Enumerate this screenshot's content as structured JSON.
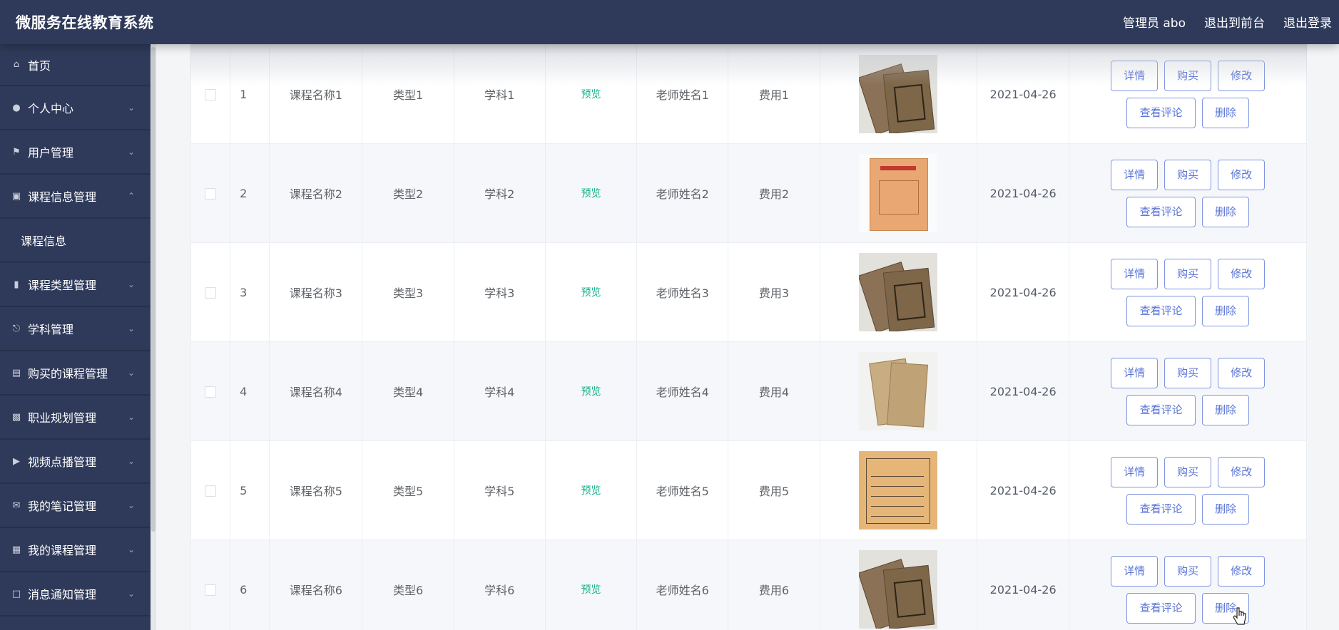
{
  "header": {
    "title": "微服务在线教育系统",
    "user_label": "管理员 abo",
    "goto_front": "退出到前台",
    "logout": "退出登录"
  },
  "sidebar": {
    "items": [
      {
        "label": "首页",
        "icon": "home-icon",
        "expandable": false
      },
      {
        "label": "个人中心",
        "icon": "person-icon",
        "expandable": true
      },
      {
        "label": "用户管理",
        "icon": "flag-icon",
        "expandable": true
      },
      {
        "label": "课程信息管理",
        "icon": "briefcase-icon",
        "expandable": true,
        "expanded": true
      },
      {
        "label": "课程类型管理",
        "icon": "bar-chart-icon",
        "expandable": true
      },
      {
        "label": "学科管理",
        "icon": "microphone-icon",
        "expandable": true
      },
      {
        "label": "购买的课程管理",
        "icon": "clipboard-icon",
        "expandable": true
      },
      {
        "label": "职业规划管理",
        "icon": "monitor-icon",
        "expandable": true
      },
      {
        "label": "视频点播管理",
        "icon": "video-icon",
        "expandable": true
      },
      {
        "label": "我的笔记管理",
        "icon": "mail-icon",
        "expandable": true
      },
      {
        "label": "我的课程管理",
        "icon": "grid-icon",
        "expandable": true
      },
      {
        "label": "消息通知管理",
        "icon": "crop-icon",
        "expandable": true
      }
    ],
    "subitem": "课程信息"
  },
  "table": {
    "actions": {
      "detail": "详情",
      "buy": "购买",
      "edit": "修改",
      "comments": "查看评论",
      "delete": "删除"
    },
    "rows": [
      {
        "index": "1",
        "course_name": "课程名称1",
        "type": "类型1",
        "subject": "学科1",
        "preview": "预览",
        "teacher": "老师姓名1",
        "fee": "费用1",
        "cover": "dark",
        "date": "2021-04-26"
      },
      {
        "index": "2",
        "course_name": "课程名称2",
        "type": "类型2",
        "subject": "学科2",
        "preview": "预览",
        "teacher": "老师姓名2",
        "fee": "费用2",
        "cover": "orange",
        "date": "2021-04-26"
      },
      {
        "index": "3",
        "course_name": "课程名称3",
        "type": "类型3",
        "subject": "学科3",
        "preview": "预览",
        "teacher": "老师姓名3",
        "fee": "费用3",
        "cover": "dark",
        "date": "2021-04-26"
      },
      {
        "index": "4",
        "course_name": "课程名称4",
        "type": "类型4",
        "subject": "学科4",
        "preview": "预览",
        "teacher": "老师姓名4",
        "fee": "费用4",
        "cover": "light",
        "date": "2021-04-26"
      },
      {
        "index": "5",
        "course_name": "课程名称5",
        "type": "类型5",
        "subject": "学科5",
        "preview": "预览",
        "teacher": "老师姓名5",
        "fee": "费用5",
        "cover": "form",
        "date": "2021-04-26"
      },
      {
        "index": "6",
        "course_name": "课程名称6",
        "type": "类型6",
        "subject": "学科6",
        "preview": "预览",
        "teacher": "老师姓名6",
        "fee": "费用6",
        "cover": "dark",
        "date": "2021-04-26"
      }
    ]
  },
  "colors": {
    "sidebar_bg": "#2f3a5a",
    "preview_link": "#13b38a",
    "button_text": "#5a74d6"
  }
}
